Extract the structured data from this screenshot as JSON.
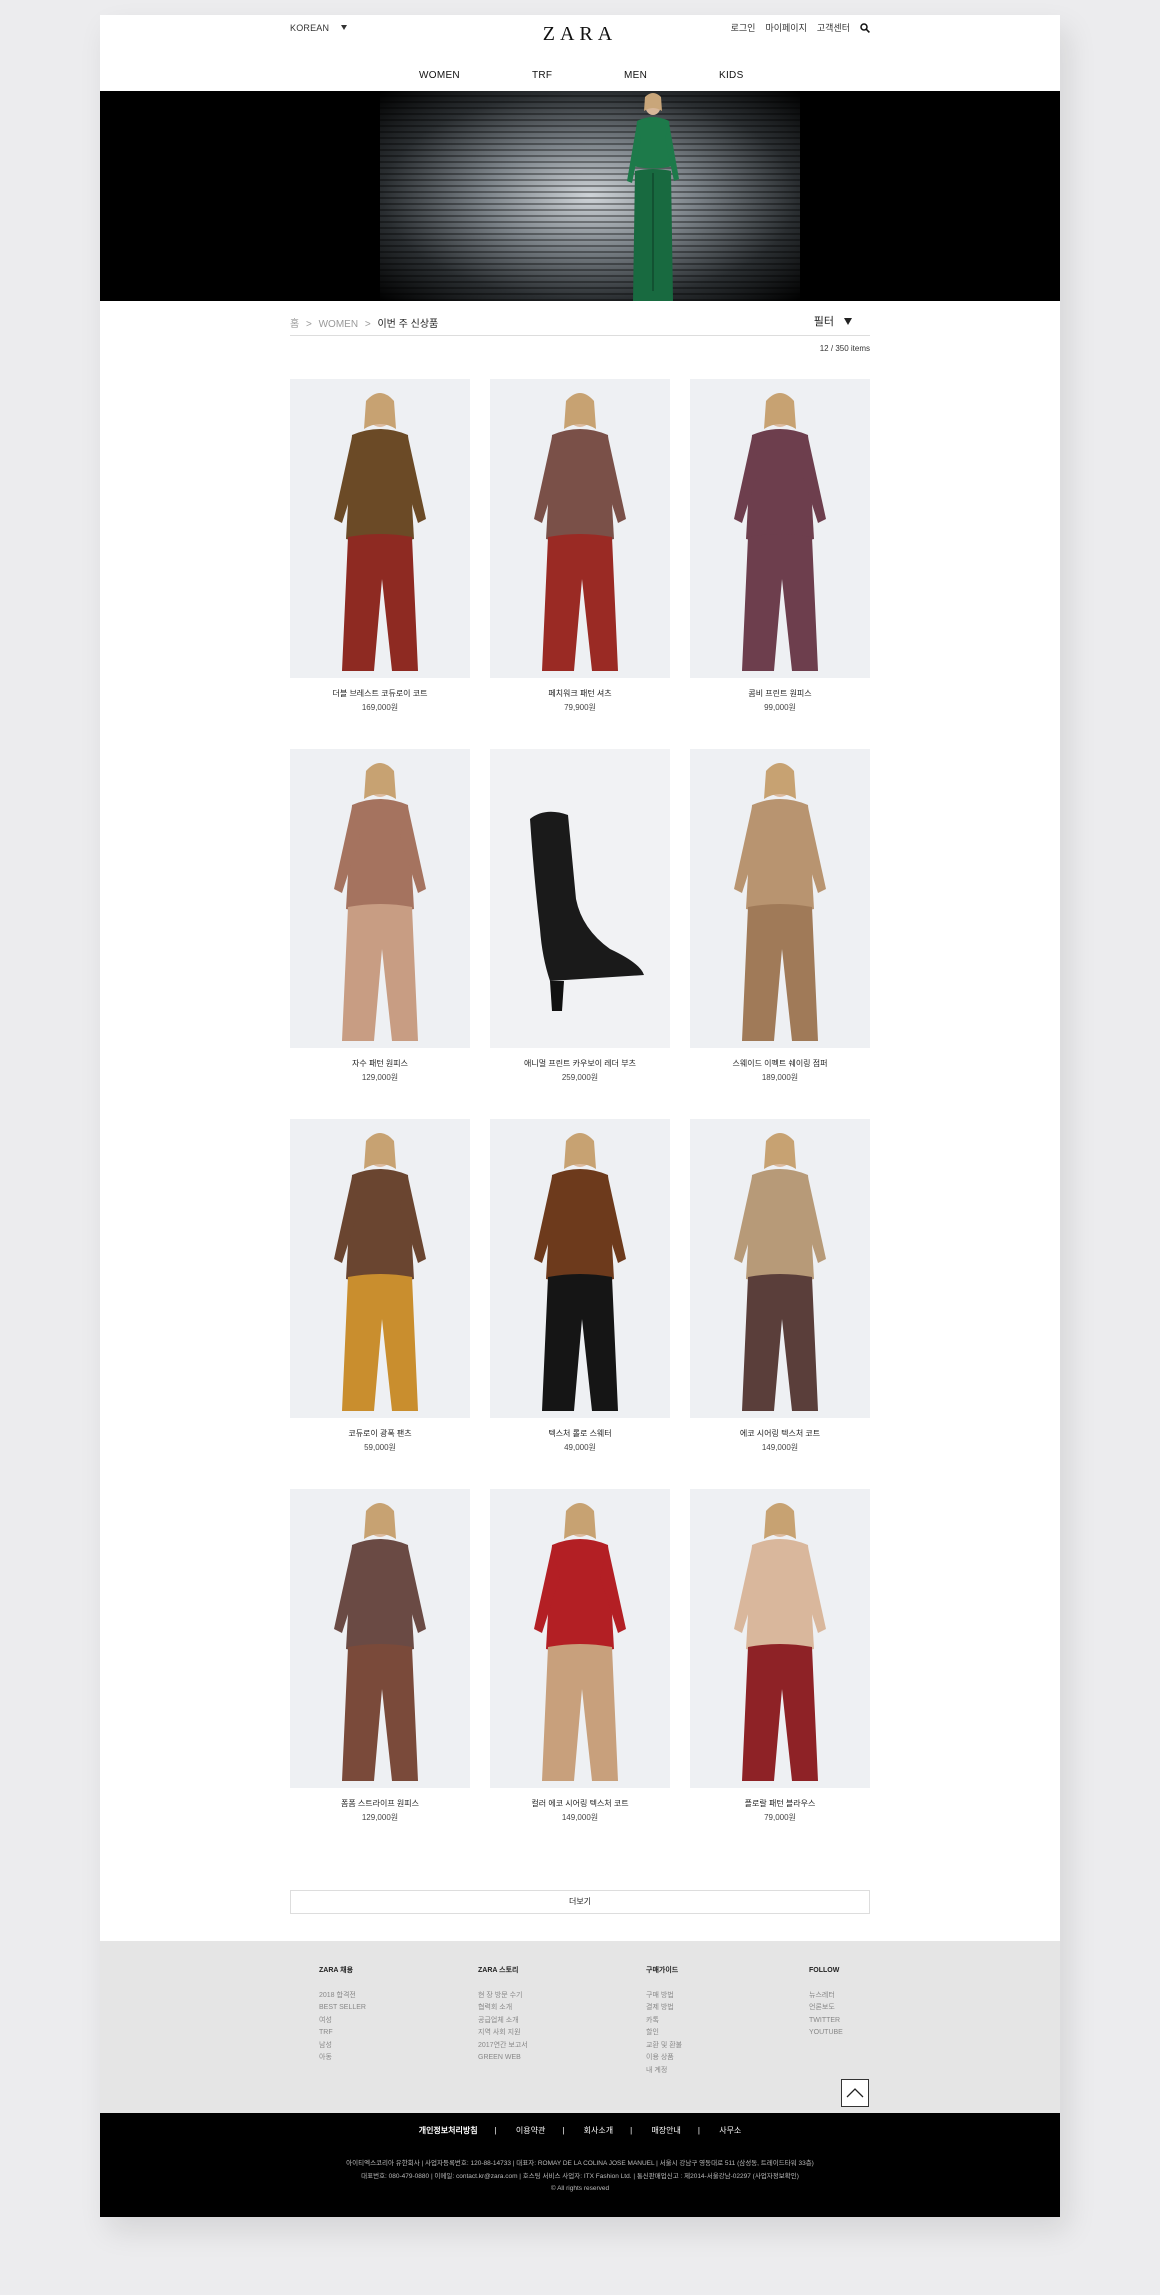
{
  "header": {
    "language": "KOREAN",
    "logo": "ZARA",
    "util": [
      "로그인",
      "마이페이지",
      "고객센터"
    ]
  },
  "nav": [
    "WOMEN",
    "TRF",
    "MEN",
    "KIDS"
  ],
  "breadcrumb": {
    "home": "홈",
    "sep": ">",
    "section": "WOMEN",
    "current": "이번 주 신상품"
  },
  "filter_label": "필터",
  "count": {
    "shown": "12",
    "slash": "/",
    "total": "350 items"
  },
  "products": [
    {
      "name": "더블 브레스트 코듀로이 코트",
      "price": "169,000원",
      "top": "#6b4a26",
      "bottom": "#8e2a22",
      "bg": "#eef0f3"
    },
    {
      "name": "페치워크 패턴 셔츠",
      "price": "79,900원",
      "top": "#7a5048",
      "bottom": "#9a2a24",
      "bg": "#eef0f3"
    },
    {
      "name": "콤비 프린트 원피스",
      "price": "99,000원",
      "top": "#6d3e4d",
      "bottom": "#6d3e4d",
      "bg": "#eef0f3"
    },
    {
      "name": "자수 패턴 원피스",
      "price": "129,000원",
      "top": "#a5735f",
      "bottom": "#c89d83",
      "bg": "#eef0f3"
    },
    {
      "name": "애니멀 프린트 카우보이 레더 부츠",
      "price": "259,000원",
      "top": "#1a1a1a",
      "bottom": "#1a1a1a",
      "bg": "#f1f2f4"
    },
    {
      "name": "스웨이드 이펙트 쉐이링 점퍼",
      "price": "189,000원",
      "top": "#b89470",
      "bottom": "#a07a58",
      "bg": "#eef0f3"
    },
    {
      "name": "코듀로이 광폭 팬츠",
      "price": "59,000원",
      "top": "#6a4530",
      "bottom": "#c98e2e",
      "bg": "#eef0f3"
    },
    {
      "name": "텍스처 롤로 스웨터",
      "price": "49,000원",
      "top": "#6d3a1c",
      "bottom": "#151515",
      "bg": "#eef0f3"
    },
    {
      "name": "에코 시어링 텍스처 코트",
      "price": "149,000원",
      "top": "#b79a78",
      "bottom": "#5a3e3a",
      "bg": "#eef0f3"
    },
    {
      "name": "폼폼 스트라이프 원피스",
      "price": "129,000원",
      "top": "#6a4a44",
      "bottom": "#7a4a3a",
      "bg": "#eef0f3"
    },
    {
      "name": "컬러 에코 시어링 텍스처 코트",
      "price": "149,000원",
      "top": "#b31f24",
      "bottom": "#c8a07c",
      "bg": "#eef0f3"
    },
    {
      "name": "플로랄 패턴 블라우스",
      "price": "79,000원",
      "top": "#d9b79c",
      "bottom": "#8e2226",
      "bg": "#eef0f3"
    }
  ],
  "more_label": "더보기",
  "footer": {
    "columns": [
      {
        "title": "ZARA 채용",
        "items": [
          "2018 합격전",
          "BEST SELLER",
          "여성",
          "TRF",
          "남성",
          "아동"
        ]
      },
      {
        "title": "ZARA 스토리",
        "items": [
          "현 장 방문 수기",
          "협력회 소개",
          "공급업체 소개",
          "지역 사회 지원",
          "2017연간 보고서",
          "GREEN WEB"
        ]
      },
      {
        "title": "구매가이드",
        "items": [
          "구매 방법",
          "결제 방법",
          "카톡",
          "할인",
          "교환 및 환불",
          "이용 상품",
          "내 계정"
        ]
      },
      {
        "title": "FOLLOW",
        "items": [
          "뉴스레터",
          "언론보도",
          "TWITTER",
          "YOUTUBE"
        ]
      }
    ],
    "links": [
      "개인정보처리방침",
      "이용약관",
      "회사소개",
      "매장안내",
      "사무소"
    ],
    "info": [
      "아이티엑스코리아 유한회사 | 사업자등록번호: 120-88-14733 | 대표자: ROMAY DE LA COLINA JOSE MANUEL | 서울시 강남구 영동대로 511 (삼성동, 트레이드타워 33층)",
      "대표번호: 080-479-0880 | 이메일: contact.kr@zara.com | 호스팅 서비스 사업자: ITX Fashion Ltd. | 통신판매업신고 : 제2014-서울강남-02297 (사업자정보확인)",
      "© All rights reserved"
    ]
  }
}
